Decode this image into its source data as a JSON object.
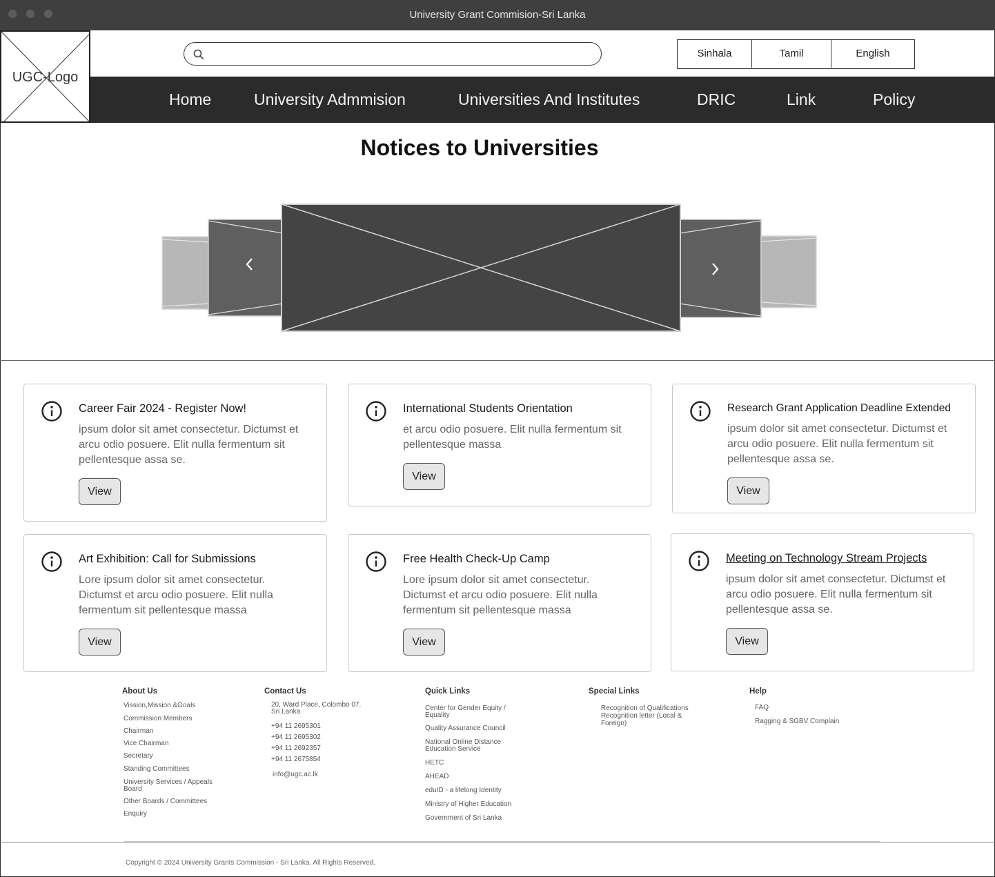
{
  "window": {
    "title": "University Grant Commision-Sri Lanka"
  },
  "header": {
    "logo_text": "UGC-Logo",
    "search": {
      "value": "",
      "placeholder": ""
    },
    "languages": [
      "Sinhala",
      "Tamil",
      "English"
    ]
  },
  "nav": {
    "items": [
      "Home",
      "University Admmision",
      "Universities And Institutes",
      "DRIC",
      "Link",
      "Policy"
    ]
  },
  "main": {
    "title": "Notices to Universities",
    "carousel": {
      "prev_icon": "chevron-left-icon",
      "next_icon": "chevron-right-icon"
    },
    "cards": [
      {
        "title": "Career Fair 2024 - Register Now!",
        "body": " ipsum dolor sit amet consectetur. Dictumst et arcu odio posuere. Elit nulla fermentum sit pellentesque assa se.",
        "button": "View"
      },
      {
        "title": "International Students Orientation",
        "body": "et arcu odio posuere. Elit nulla fermentum sit pellentesque massa",
        "button": "View"
      },
      {
        "title": "Research Grant Application Deadline Extended",
        "body": " ipsum dolor sit amet consectetur. Dictumst et arcu odio posuere. Elit nulla fermentum sit pellentesque assa se.",
        "button": "View"
      },
      {
        "title": "Art Exhibition: Call for Submissions",
        "body": "Lore ipsum dolor sit amet consectetur. Dictumst et arcu odio posuere. Elit nulla fermentum sit pellentesque massa",
        "button": "View"
      },
      {
        "title": " Free Health Check-Up Camp",
        "body": "Lore ipsum dolor sit amet consectetur. Dictumst et arcu odio posuere. Elit nulla fermentum sit pellentesque massa",
        "button": "View"
      },
      {
        "title": "Meeting on Technology Stream Projects ",
        "body": " ipsum dolor sit amet consectetur. Dictumst et arcu odio posuere. Elit nulla fermentum sit pellentesque assa se.",
        "button": "View"
      }
    ]
  },
  "footer": {
    "about": {
      "heading": "About Us",
      "links": [
        "Vission,Mission &Goals",
        "Commission Members",
        "Chairman",
        "Vice Chairman",
        "Secretary",
        "Standing Committees",
        "University Services / Appeals Board",
        "Other Boards / Committees",
        "Enquiry"
      ]
    },
    "contact": {
      "heading": "Contact Us",
      "address": "20, Ward Place, Colombo 07. Sri Lanka",
      "phones": [
        "+94 11 2695301",
        "+94 11 2695302",
        "+94 11 2692357",
        "+94 11 2675854"
      ],
      "email": "info@ugc.ac.lk"
    },
    "quick": {
      "heading": "Quick Links",
      "links": [
        "Center for Gender Equity / Equality",
        "Quality Assurance Council",
        "National Online Distance Education Service",
        "HETC",
        "AHEAD",
        "eduID - a lifelong Identity",
        "Ministry of Higher Education",
        "Government of Sri Lanka"
      ]
    },
    "special": {
      "heading": "Special Links",
      "links": [
        "Recognition of Qualifications Recognition letter (Local & Foreign)"
      ]
    },
    "help": {
      "heading": "Help",
      "links": [
        "FAQ",
        "Ragging & SGBV Complain"
      ]
    },
    "copyright": "Copyright © 2024 University Grants Commission - Sri Lanka. All Rights Reserved."
  }
}
